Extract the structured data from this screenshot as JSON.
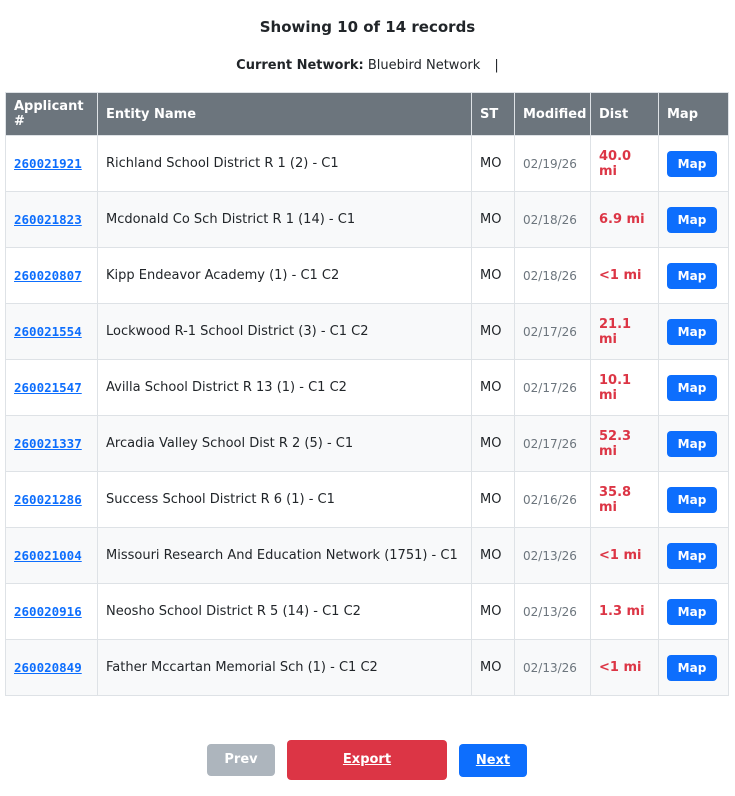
{
  "summary": "Showing 10 of 14 records",
  "network": {
    "label": "Current Network:",
    "value": "Bluebird Network",
    "separator": "|"
  },
  "table": {
    "headers": [
      "Applicant #",
      "Entity Name",
      "ST",
      "Modified",
      "Dist",
      "Map"
    ],
    "rows": [
      {
        "applicant": "260021921",
        "entity": "Richland School District R 1 (2) - C1",
        "st": "MO",
        "modified": "02/19/26",
        "dist": "40.0 mi",
        "map": "Map"
      },
      {
        "applicant": "260021823",
        "entity": "Mcdonald Co Sch District R 1 (14) - C1",
        "st": "MO",
        "modified": "02/18/26",
        "dist": "6.9 mi",
        "map": "Map"
      },
      {
        "applicant": "260020807",
        "entity": "Kipp Endeavor Academy (1) - C1 C2",
        "st": "MO",
        "modified": "02/18/26",
        "dist": "<1 mi",
        "map": "Map"
      },
      {
        "applicant": "260021554",
        "entity": "Lockwood R-1 School District (3) - C1 C2",
        "st": "MO",
        "modified": "02/17/26",
        "dist": "21.1 mi",
        "map": "Map"
      },
      {
        "applicant": "260021547",
        "entity": "Avilla School District R 13 (1) - C1 C2",
        "st": "MO",
        "modified": "02/17/26",
        "dist": "10.1 mi",
        "map": "Map"
      },
      {
        "applicant": "260021337",
        "entity": "Arcadia Valley School Dist R 2 (5) - C1",
        "st": "MO",
        "modified": "02/17/26",
        "dist": "52.3 mi",
        "map": "Map"
      },
      {
        "applicant": "260021286",
        "entity": "Success School District R 6 (1) - C1",
        "st": "MO",
        "modified": "02/16/26",
        "dist": "35.8 mi",
        "map": "Map"
      },
      {
        "applicant": "260021004",
        "entity": "Missouri Research And Education Network (1751) - C1",
        "st": "MO",
        "modified": "02/13/26",
        "dist": "<1 mi",
        "map": "Map"
      },
      {
        "applicant": "260020916",
        "entity": "Neosho School District R 5 (14) - C1 C2",
        "st": "MO",
        "modified": "02/13/26",
        "dist": "1.3 mi",
        "map": "Map"
      },
      {
        "applicant": "260020849",
        "entity": "Father Mccartan Memorial Sch (1) - C1 C2",
        "st": "MO",
        "modified": "02/13/26",
        "dist": "<1 mi",
        "map": "Map"
      }
    ]
  },
  "pager": {
    "prev_label": "Prev",
    "export_label": "Export",
    "next_label": "Next"
  },
  "colors": {
    "header_bg": "#6c757d",
    "link": "#0d6efd",
    "dist": "#dc3545",
    "map_button": "#0d6efd",
    "export_button": "#dc3545",
    "prev_button": "#adb5bd",
    "next_button": "#0d6efd"
  }
}
